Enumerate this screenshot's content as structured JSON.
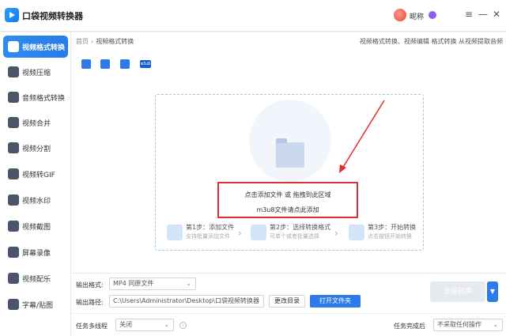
{
  "app": {
    "title": "口袋视频转换器",
    "user_name": "昵称",
    "window_controls": [
      "menu-icon",
      "minimize-icon",
      "close-icon"
    ]
  },
  "sidebar": {
    "items": [
      {
        "label": "视频格式转换",
        "icon": "video-convert-icon",
        "active": true
      },
      {
        "label": "视频压缩",
        "icon": "compress-icon",
        "active": false
      },
      {
        "label": "音频格式转换",
        "icon": "audio-convert-icon",
        "active": false
      },
      {
        "label": "视频合并",
        "icon": "merge-icon",
        "active": false
      },
      {
        "label": "视频分割",
        "icon": "split-icon",
        "active": false
      },
      {
        "label": "视频转GIF",
        "icon": "gif-icon",
        "active": false
      },
      {
        "label": "视频水印",
        "icon": "watermark-icon",
        "active": false
      },
      {
        "label": "视频截图",
        "icon": "screenshot-icon",
        "active": false
      },
      {
        "label": "屏幕录像",
        "icon": "screen-record-icon",
        "active": false
      },
      {
        "label": "视频配乐",
        "icon": "music-icon",
        "active": false
      },
      {
        "label": "字幕/贴图",
        "icon": "subtitle-icon",
        "active": false
      }
    ]
  },
  "main": {
    "breadcrumb": {
      "home": "首页",
      "separator": "›",
      "current": "视频格式转换"
    },
    "top_links": "视频格式转换、视频编辑 格式转换 从视频提取音频",
    "toolbar": [
      {
        "name": "add-file-icon"
      },
      {
        "name": "add-folder-icon"
      },
      {
        "name": "batch-icon"
      },
      {
        "name": "m3u8-icon",
        "text": "m3u8"
      }
    ],
    "dropzone": {
      "hint_line1": "点击添加文件 或 拖拽到此区域",
      "hint_line2": "m3u8文件请点此添加",
      "steps": [
        {
          "title": "第1步：添加文件",
          "sub": "支持批量添加文件"
        },
        {
          "title": "第2步：选择转换格式",
          "sub": "可单个或者批量选择"
        },
        {
          "title": "第3步：开始转换",
          "sub": "点击按钮开始转换"
        }
      ]
    }
  },
  "bottom": {
    "output_format_label": "输出格式:",
    "output_format_value": "MP4  同原文件",
    "output_path_label": "输出路径:",
    "output_path_value": "C:\\Users\\Administrator\\Desktop\\口袋视频转换器",
    "change_dir_label": "更改目录",
    "open_folder_label": "打开文件夹",
    "convert_all_label": "全部转换",
    "multithread_label": "任务多线程",
    "multithread_value": "关闭",
    "after_complete_label": "任务完成后",
    "after_complete_value": "不采取任何操作"
  },
  "colors": {
    "accent": "#2d7be8",
    "annotation": "#e03030"
  }
}
